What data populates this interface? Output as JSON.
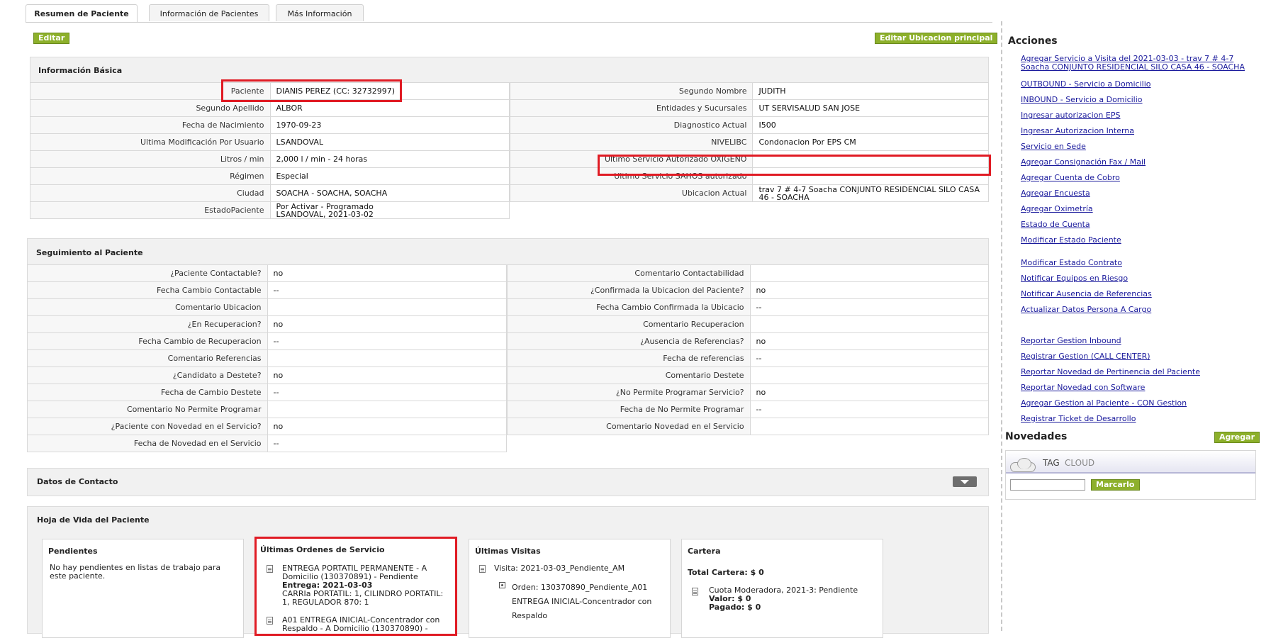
{
  "tabs": [
    "Resumen de Paciente",
    "Información de Pacientes",
    "Más Información"
  ],
  "buttons": {
    "editar": "Editar",
    "editar_ubicacion": "Editar Ubicacion principal",
    "agregar": "Agregar",
    "marcarlo": "Marcarlo"
  },
  "basic_info": {
    "title": "Información Básica",
    "left": [
      {
        "label": "Paciente",
        "value": "DIANIS PEREZ (CC: 32732997)"
      },
      {
        "label": "Segundo Apellido",
        "value": "ALBOR"
      },
      {
        "label": "Fecha de Nacimiento",
        "value": "1970-09-23"
      },
      {
        "label": "Ultima Modificación Por Usuario",
        "value": "LSANDOVAL"
      },
      {
        "label": "Litros / min",
        "value": "2,000 l / min - 24 horas"
      },
      {
        "label": "Régimen",
        "value": "Especial"
      },
      {
        "label": "Ciudad",
        "value": "SOACHA - SOACHA, SOACHA"
      },
      {
        "label": "EstadoPaciente",
        "value": "Por Activar - Programado",
        "value2": "LSANDOVAL, 2021-03-02"
      }
    ],
    "right": [
      {
        "label": "Segundo Nombre",
        "value": "JUDITH"
      },
      {
        "label": "Entidades y Sucursales",
        "value": "UT SERVISALUD SAN JOSE"
      },
      {
        "label": "Diagnostico Actual",
        "value": "I500"
      },
      {
        "label": "NIVELIBC",
        "value": "Condonacion Por EPS CM"
      },
      {
        "label": "Último Servicio Autorizado OXIGENO",
        "value": ""
      },
      {
        "label": "Ultimo Servicio SAHOS autorizado",
        "value": ""
      },
      {
        "label": "Ubicacion Actual",
        "value": "trav 7 # 4-7 Soacha CONJUNTO RESIDENCIAL SILO CASA 46 - SOACHA"
      }
    ]
  },
  "seguimiento": {
    "title": "Seguimiento al Paciente",
    "left": [
      {
        "label": "¿Paciente Contactable?",
        "value": "no"
      },
      {
        "label": "Fecha Cambio Contactable",
        "value": "--"
      },
      {
        "label": "Comentario Ubicacion",
        "value": ""
      },
      {
        "label": "¿En Recuperacion?",
        "value": "no"
      },
      {
        "label": "Fecha Cambio de Recuperacion",
        "value": "--"
      },
      {
        "label": "Comentario Referencias",
        "value": ""
      },
      {
        "label": "¿Candidato a Destete?",
        "value": "no"
      },
      {
        "label": "Fecha de Cambio Destete",
        "value": "--"
      },
      {
        "label": "Comentario No Permite Programar",
        "value": ""
      },
      {
        "label": "¿Paciente con Novedad en el Servicio?",
        "value": "no"
      },
      {
        "label": "Fecha de Novedad en el Servicio",
        "value": "--"
      }
    ],
    "right": [
      {
        "label": "Comentario Contactabilidad",
        "value": ""
      },
      {
        "label": "¿Confirmada la Ubicacion del Paciente?",
        "value": "no"
      },
      {
        "label": "Fecha Cambio Confirmada la Ubicacio",
        "value": "--"
      },
      {
        "label": "Comentario Recuperacion",
        "value": ""
      },
      {
        "label": "¿Ausencia de Referencias?",
        "value": "no"
      },
      {
        "label": "Fecha de referencias",
        "value": "--"
      },
      {
        "label": "Comentario Destete",
        "value": ""
      },
      {
        "label": "¿No Permite Programar Servicio?",
        "value": "no"
      },
      {
        "label": "Fecha de No Permite Programar",
        "value": "--"
      },
      {
        "label": "Comentario Novedad en el Servicio",
        "value": ""
      }
    ]
  },
  "contacto": {
    "title": "Datos de Contacto"
  },
  "hoja_vida": {
    "title": "Hoja de Vida del Paciente",
    "pendientes": {
      "title": "Pendientes",
      "text": "No hay pendientes en listas de trabajo para este paciente."
    },
    "ordenes": {
      "title": "Últimas Ordenes de Servicio",
      "item1_line1": "ENTREGA PORTATIL PERMANENTE - A",
      "item1_line2": "Domicilio (130370891) - Pendiente",
      "item1_entrega": "Entrega: 2021-03-03",
      "item1_line4": "CARRIa PORTATIL: 1, CILINDRO PORTATIL:",
      "item1_line5": "1, REGULADOR 870: 1",
      "item2_line1": "A01 ENTREGA INICIAL-Concentrador con",
      "item2_line2": "Respaldo - A Domicilio (130370890) -"
    },
    "visitas": {
      "title": "Últimas Visitas",
      "visita": "Visita: 2021-03-03_Pendiente_AM",
      "orden_line1": "Orden: 130370890_Pendiente_A01",
      "orden_line2": "ENTREGA INICIAL-Concentrador con",
      "orden_line3": "Respaldo"
    },
    "cartera": {
      "title": "Cartera",
      "total": "Total Cartera: $ 0",
      "cuota": "Cuota Moderadora, 2021-3: Pendiente",
      "valor": "Valor: $ 0",
      "pagado": "Pagado: $ 0"
    }
  },
  "acciones": {
    "title": "Acciones",
    "links": [
      "Agregar Servicio a Visita del 2021-03-03 - trav 7 # 4-7 Soacha CONJUNTO RESIDENCIAL SILO CASA 46 - SOACHA",
      "OUTBOUND - Servicio a Domicilio",
      "INBOUND - Servicio a Domicilio",
      "Ingresar autorizacion EPS",
      "Ingresar Autorizacion Interna",
      "Servicio en Sede",
      "Agregar Consignación Fax / Mail",
      "Agregar Cuenta de Cobro",
      "Agregar Encuesta",
      "Agregar Oximetría",
      "Estado de Cuenta",
      "Modificar Estado Paciente",
      "Modificar Estado Contrato",
      "Notificar Equipos en Riesgo",
      "Notificar Ausencia de Referencias",
      "Actualizar Datos Persona A Cargo",
      "Reportar Gestion Inbound",
      "Registrar Gestion (CALL CENTER)",
      "Reportar Novedad de Pertinencia del Paciente",
      "Reportar Novedad con Software",
      "Agregar Gestion al Paciente - CON Gestion",
      "Registrar Ticket de Desarrollo"
    ]
  },
  "novedades": {
    "title": "Novedades",
    "tag": "TAG",
    "cloud": "CLOUD",
    "input_value": ""
  }
}
